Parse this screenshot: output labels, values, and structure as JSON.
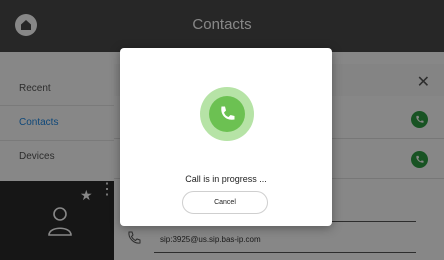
{
  "header": {
    "title": "Contacts",
    "home_icon": "home-icon"
  },
  "sidebar": {
    "items": [
      {
        "label": "Recent",
        "active": false
      },
      {
        "label": "Contacts",
        "active": true
      },
      {
        "label": "Devices",
        "active": false
      }
    ],
    "active_color": "#1e88e5"
  },
  "contact_detail": {
    "sip": "sip:3925@us.sip.bas-ip.com"
  },
  "dialog": {
    "status": "Call is in progress ...",
    "cancel_label": "Cancel",
    "call_color": "#6cc152"
  },
  "colors": {
    "topbar": "#4a4a4a",
    "call_green": "#2e9e43"
  }
}
